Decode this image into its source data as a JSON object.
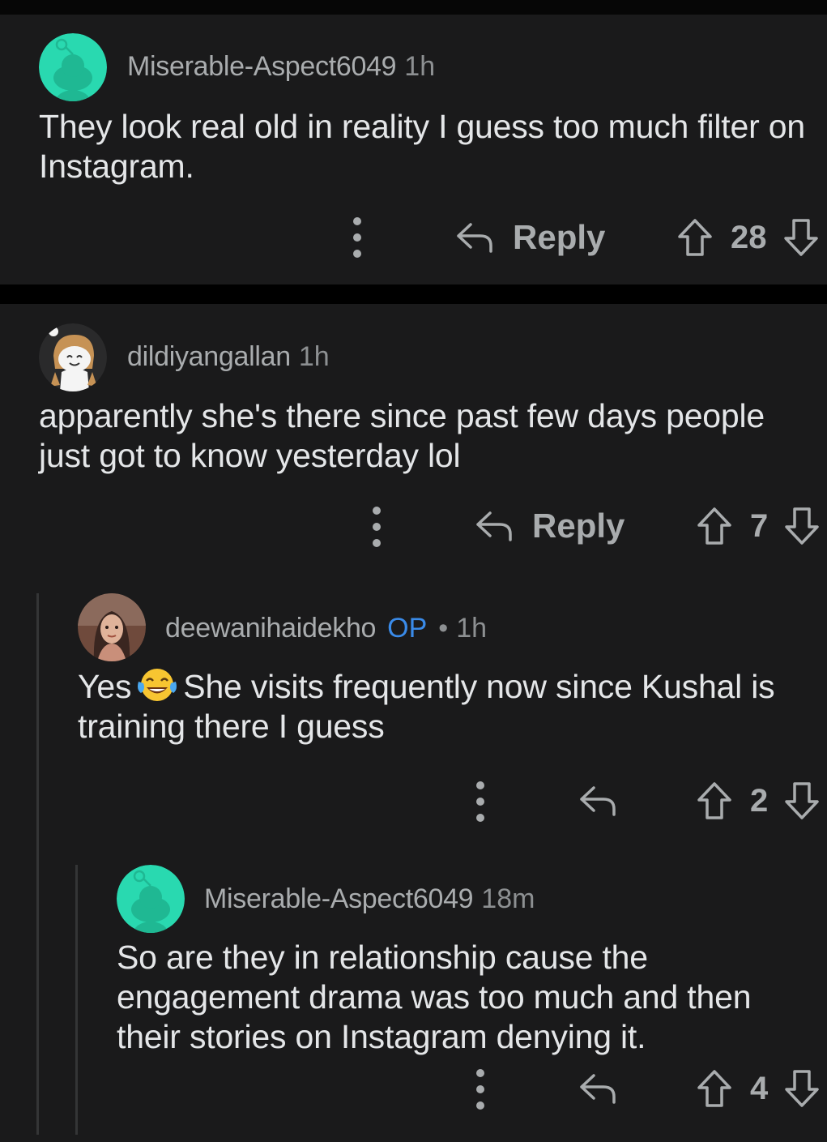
{
  "colors": {
    "card_background": "#1a1a1b",
    "page_background": "#000000",
    "op_badge": "#3a8be9",
    "snoo_teal": "#29d9b0"
  },
  "comments": [
    {
      "username": "Miserable-Aspect6049",
      "time": "1h",
      "avatar_icon": "snoo-teal-avatar",
      "body": "They look real old in reality I guess too much filter on Instagram.",
      "reply_label": "Reply",
      "votes": "28"
    },
    {
      "username": "dildiyangallan",
      "time": "1h",
      "avatar_icon": "snoo-costume-avatar",
      "body": "apparently she's there since past few days people just got to know yesterday lol",
      "reply_label": "Reply",
      "votes": "7"
    },
    {
      "username": "deewanihaidekho",
      "op_badge": "OP",
      "separator": "•",
      "time": "1h",
      "avatar_icon": "profile-photo-avatar",
      "body_before_emoji": "Yes",
      "emoji": "face-with-tears-of-joy-emoji",
      "body_after_emoji": "She visits frequently now since Kushal is training there I guess",
      "votes": "2"
    },
    {
      "username": "Miserable-Aspect6049",
      "time": "18m",
      "avatar_icon": "snoo-teal-avatar",
      "body": "So are they in relationship cause the engagement drama was too much and then their stories on Instagram denying it.",
      "votes": "4"
    }
  ],
  "icons": {
    "more": "more-options-icon",
    "reply": "reply-arrow-icon",
    "upvote": "upvote-arrow-icon",
    "downvote": "downvote-arrow-icon"
  }
}
